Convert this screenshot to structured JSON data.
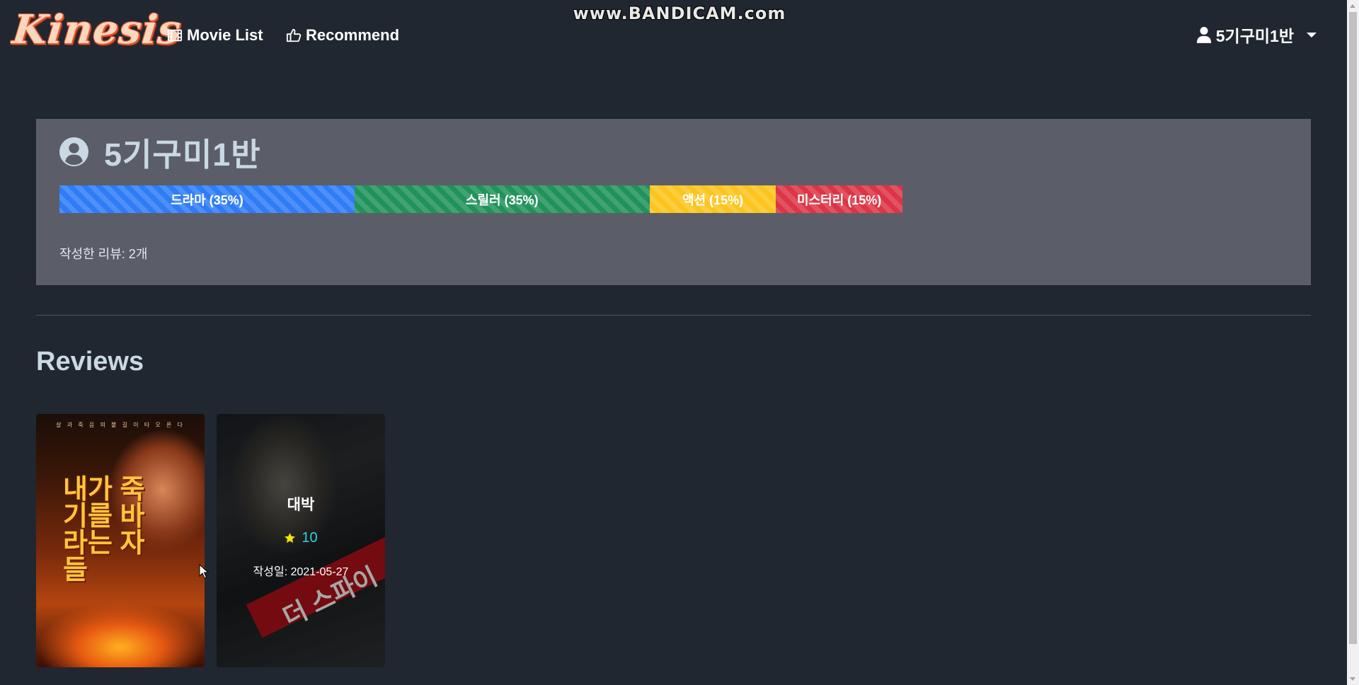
{
  "watermark": "www.BANDICAM.com",
  "nav": {
    "logo": "Kinesis",
    "movie_list": "Movie List",
    "recommend": "Recommend",
    "user": "5기구미1반",
    "icons": {
      "movie_list": "film-icon",
      "recommend": "thumbs-up-icon",
      "user": "user-icon"
    }
  },
  "profile": {
    "username": "5기구미1반",
    "icon": "user-circle-icon",
    "genres": [
      {
        "label": "드라마 (35%)",
        "percent": 35,
        "color": "#2e7cf6"
      },
      {
        "label": "스릴러 (35%)",
        "percent": 35,
        "color": "#20925a"
      },
      {
        "label": "액션 (15%)",
        "percent": 15,
        "color": "#fcc41c"
      },
      {
        "label": "미스터리 (15%)",
        "percent": 15,
        "color": "#dc3545"
      }
    ],
    "review_count": "작성한 리뷰: 2개"
  },
  "reviews_title": "Reviews",
  "reviews": [
    {
      "poster_title": "내가 죽기를 바라는 자들",
      "poster_tag": "살 과 죽 음 의 불 길 이 타 오 른 다"
    },
    {
      "poster_title": "더 스파이",
      "review_title": "대박",
      "rating": "10",
      "date": "작성일: 2021-05-27",
      "rating_color": "#33d1e8",
      "star_color": "#f5e600"
    }
  ]
}
